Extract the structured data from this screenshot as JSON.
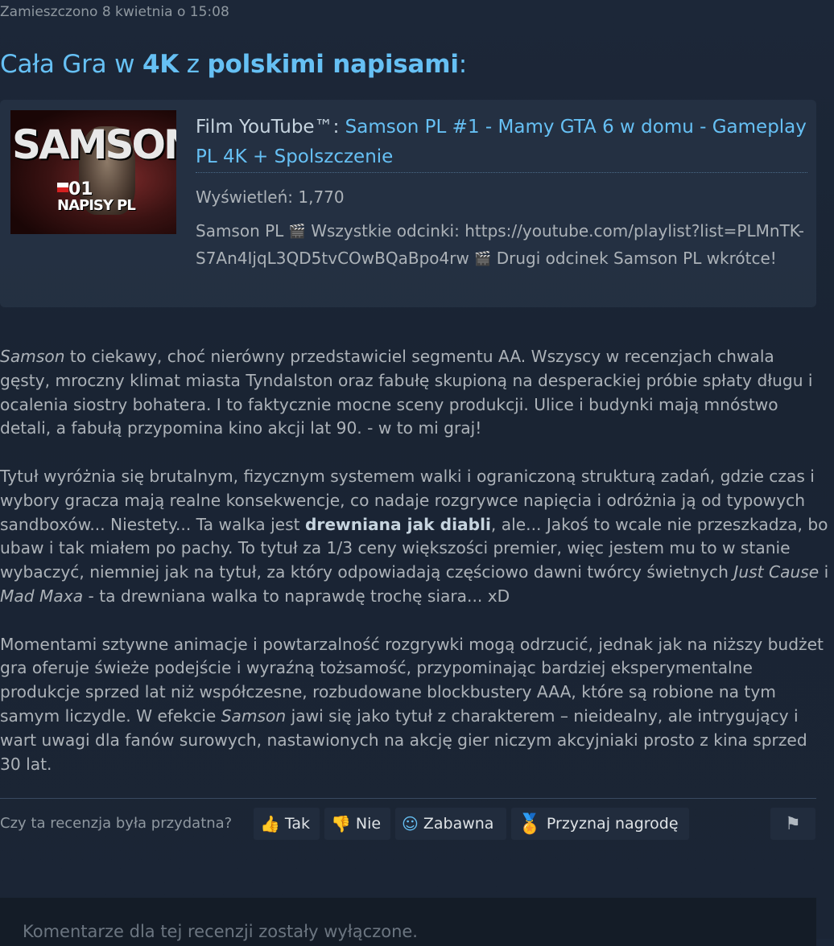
{
  "posted": "Zamieszczono 8 kwietnia o 15:08",
  "heading": {
    "pre": "Cała Gra w ",
    "bold1": "4K",
    "mid": " z ",
    "bold2": "polskimi napisami",
    "post": ":"
  },
  "video": {
    "thumb_title": "SAMSON",
    "thumb_episode": "01",
    "thumb_subtitle": "NAPISY PL",
    "prefix": "Film YouTube™: ",
    "title": "Samson PL #1 - Mamy GTA 6 w domu - Gameplay PL 4K + Spolszczenie",
    "views": "Wyświetleń: 1,770",
    "desc_part1": "Samson PL ",
    "desc_part2": " Wszystkie odcinki: https://youtube.com/playlist?list=PLMnTK-S7An4IjqL3QD5tvCOwBQaBpo4rw ",
    "desc_part3": " Drugi odcinek Samson PL wkrótce!",
    "emoji_icon": "clapperboard-icon"
  },
  "review": {
    "p1": {
      "italic": "Samson",
      "text": " to ciekawy, choć nierówny przedstawiciel segmentu AA. Wszyscy w recenzjach chwala gęsty, mroczny klimat miasta Tyndalston oraz fabułę skupioną na desperackiej próbie spłaty długu i ocalenia siostry bohatera. I to faktycznie mocne sceny produkcji. Ulice i budynki mają mnóstwo detali, a fabułą przypomina kino akcji lat 90. - w to mi graj!"
    },
    "p2": {
      "text1": "Tytuł wyróżnia się brutalnym, fizycznym systemem walki i ograniczoną strukturą zadań, gdzie czas i wybory gracza mają realne konsekwencje, co nadaje rozgrywce napięcia i odróżnia ją od typowych sandboxów... Niestety... Ta walka jest ",
      "bold": "drewniana jak diabli",
      "text2": ", ale... Jakoś to wcale nie przeszkadza, bo ubaw i tak miałem po pachy. To tytuł za 1/3 ceny większości premier, więc jestem mu to w stanie wybaczyć, niemniej jak na tytuł, za który odpowiadają częściowo dawni twórcy świetnych ",
      "italic1": "Just Cause",
      "text3": " i ",
      "italic2": "Mad Maxa",
      "text4": " - ta drewniana walka to naprawdę trochę siara... xD"
    },
    "p3": {
      "text1": "Momentami sztywne animacje i powtarzalność rozgrywki mogą odrzucić, jednak jak na niższy budżet gra oferuje świeże podejście i wyraźną tożsamość, przypominając bardziej eksperymentalne produkcje sprzed lat niż współczesne, rozbudowane blockbustery AAA, które są robione na tym samym liczydle. W efekcie ",
      "italic": "Samson",
      "text2": " jawi się jako tytuł z charakterem – nieidealny, ale intrygujący i wart uwagi dla fanów surowych, nastawionych na akcję gier niczym akcyjniaki prosto z kina sprzed 30 lat."
    }
  },
  "helpful": {
    "label": "Czy ta recenzja była przydatna?",
    "yes": "Tak",
    "no": "Nie",
    "funny": "Zabawna",
    "award": "Przyznaj nagrodę"
  },
  "comments": {
    "disabled_text": "Komentarze dla tej recenzji zostały wyłączone."
  }
}
